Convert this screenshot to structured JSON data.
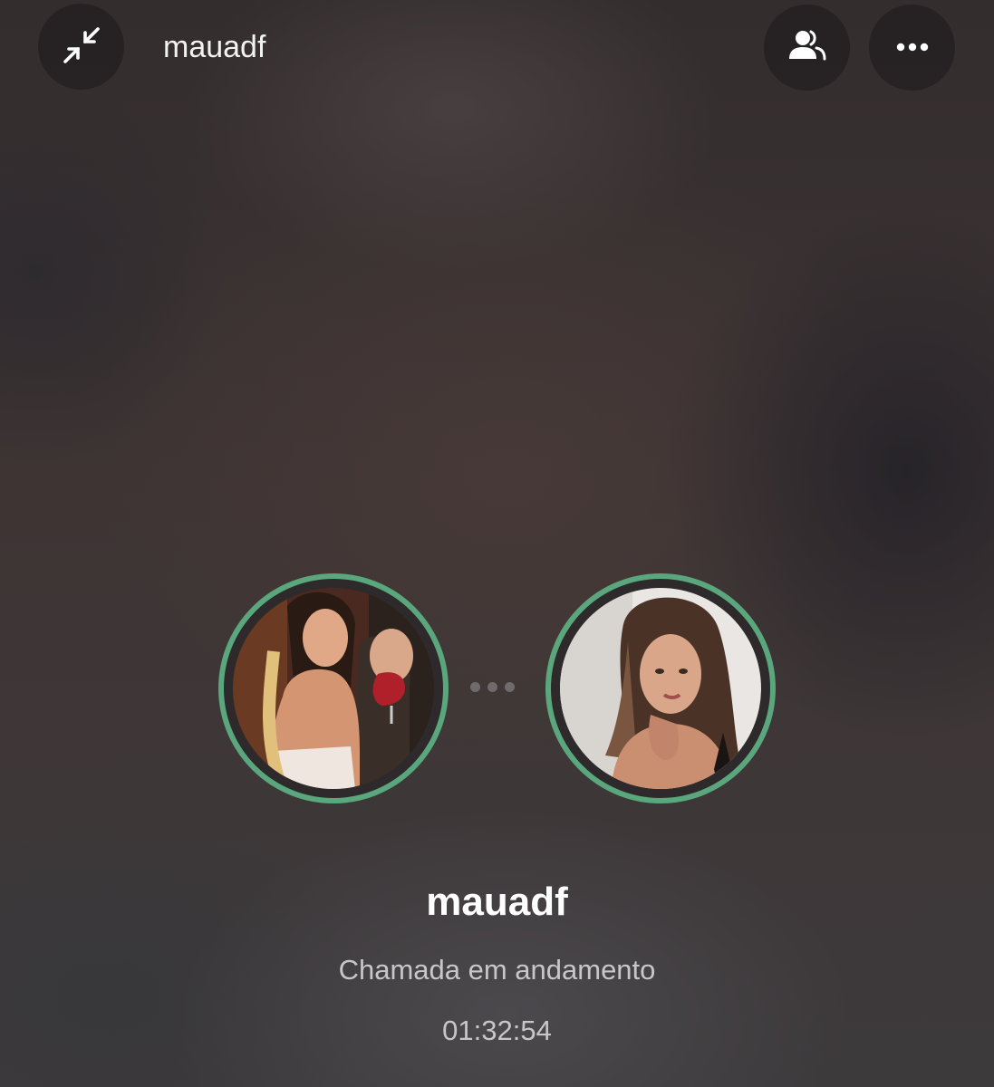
{
  "header": {
    "title": "mauadf",
    "icons": {
      "minimize": "minimize-arrows-icon",
      "participants": "participants-icon",
      "more": "more-dots-icon"
    }
  },
  "call": {
    "participants": [
      {
        "avatar": "user-avatar-photo",
        "ring_color": "#5aa67d"
      },
      {
        "avatar": "contact-avatar-photo",
        "ring_color": "#5aa67d"
      }
    ],
    "name": "mauadf",
    "status": "Chamada em andamento",
    "duration": "01:32:54"
  }
}
